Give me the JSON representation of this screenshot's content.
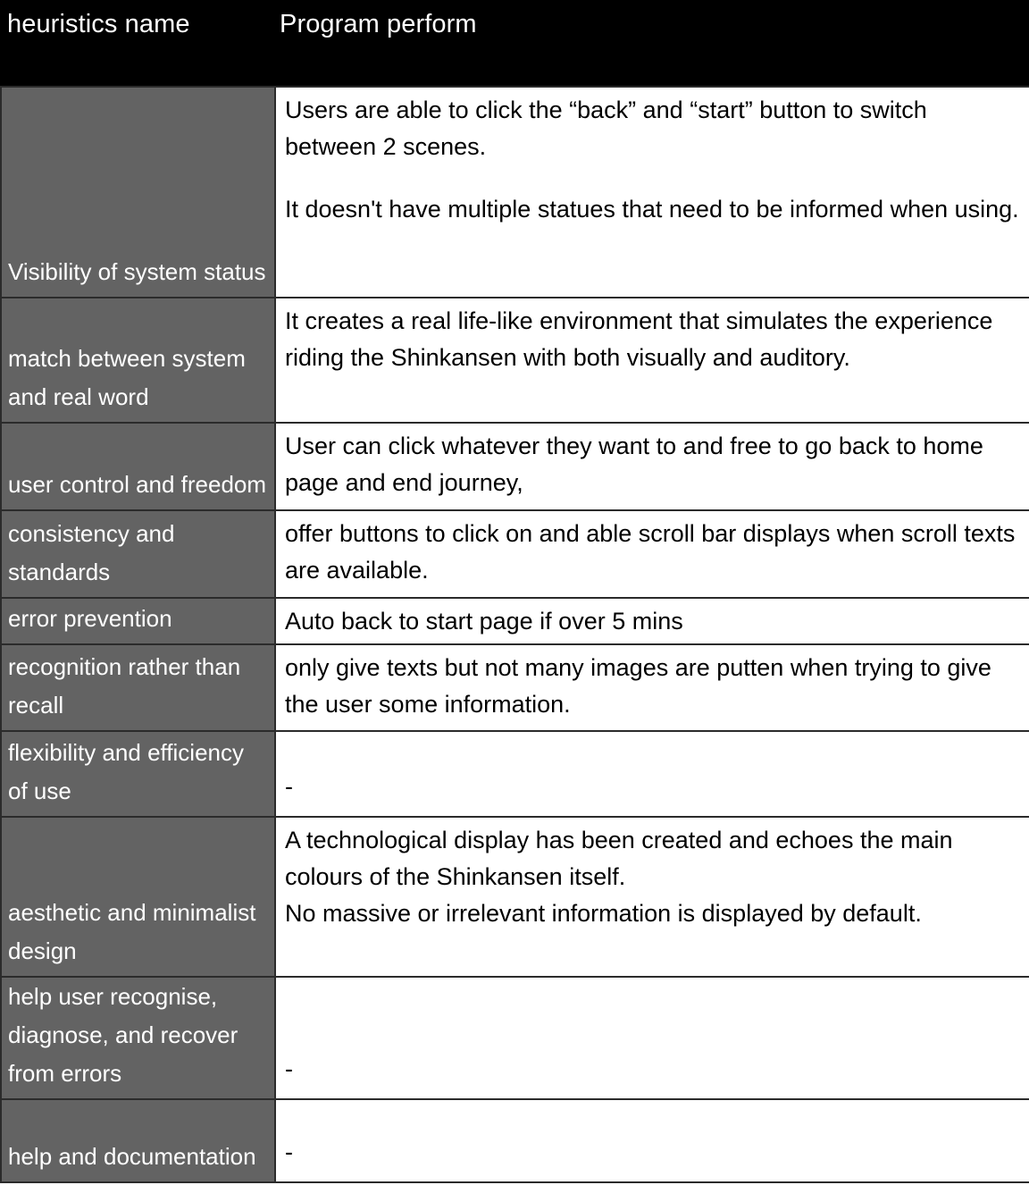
{
  "table": {
    "columns": [
      {
        "key": "heuristics_name",
        "label": "heuristics name"
      },
      {
        "key": "program_perform",
        "label": "Program perform"
      }
    ],
    "rows": [
      {
        "name": "Visibility of system status",
        "desc_lines": [
          "Users are able to click the “back” and “start” button to switch between 2 scenes.",
          "It doesn't have multiple statues that need to be informed when using."
        ]
      },
      {
        "name": "match between system and real word",
        "desc_lines": [
          "It creates a real life-like environment that simulates the experience riding the Shinkansen with both visually and auditory."
        ]
      },
      {
        "name": "user control and freedom",
        "desc_lines": [
          "User can click whatever they want to and free to go back to home page and end journey,"
        ]
      },
      {
        "name": "consistency and standards",
        "desc_lines": [
          "offer buttons to click on and able scroll bar displays when scroll texts are available."
        ]
      },
      {
        "name": "error prevention",
        "desc_lines": [
          "Auto back to start page if over 5 mins"
        ]
      },
      {
        "name": "recognition rather than recall",
        "desc_lines": [
          "only give texts but not many images are putten when trying to give the user some information."
        ]
      },
      {
        "name": "flexibility and efficiency of use",
        "desc_lines": [
          "-"
        ]
      },
      {
        "name": "aesthetic and minimalist design",
        "desc_lines": [
          "A technological display has been created and echoes the main colours of the Shinkansen itself.",
          "No massive or irrelevant information is displayed by default."
        ]
      },
      {
        "name": "help user recognise, diagnose, and recover from errors",
        "desc_lines": [
          "-"
        ]
      },
      {
        "name": "help and documentation",
        "desc_lines": [
          "-"
        ]
      }
    ]
  },
  "colors": {
    "header_background": "#000000",
    "header_text": "#ffffff",
    "name_cell_background": "#636363",
    "name_cell_text": "#ffffff",
    "desc_cell_background": "#ffffff",
    "desc_cell_text": "#000000",
    "grid_line": "#2b2b2b"
  }
}
